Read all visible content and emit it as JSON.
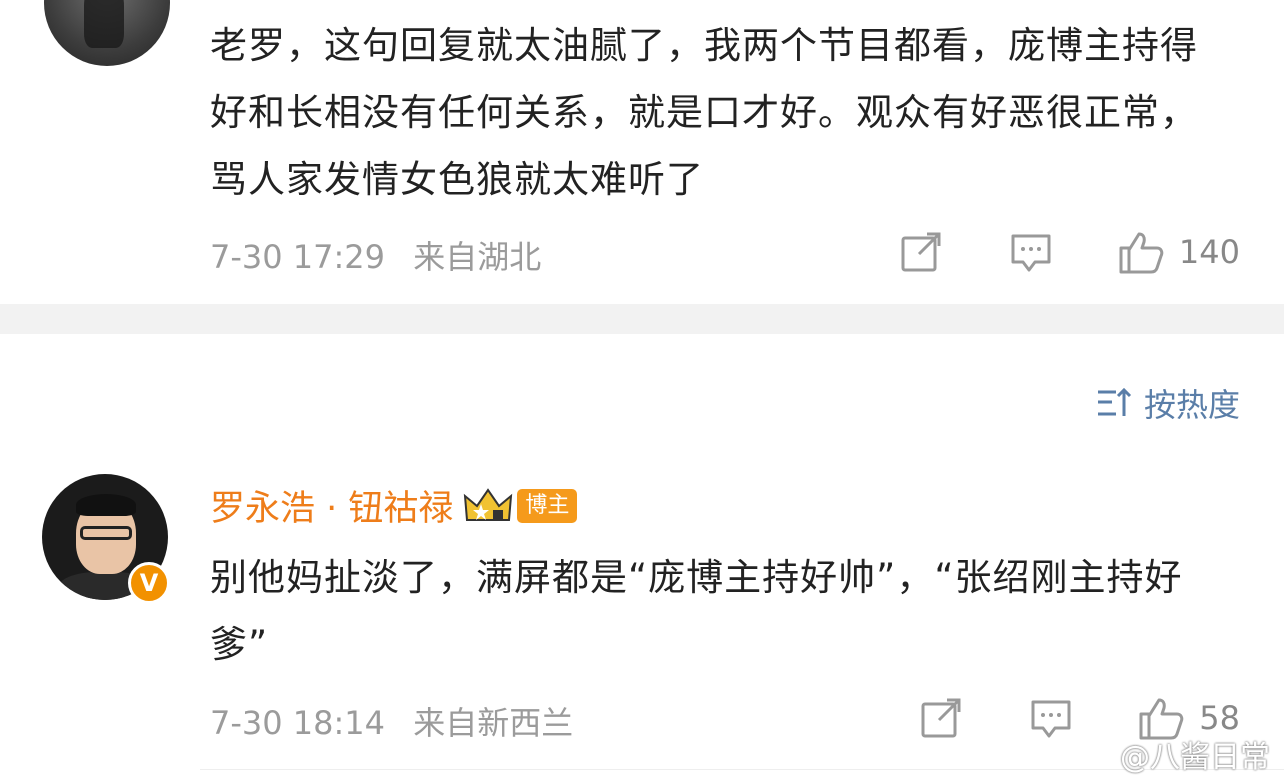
{
  "comments": [
    {
      "text": "老罗，这句回复就太油腻了，我两个节目都看，庞博主持得好和长相没有任何关系，就是口才好。观众有好恶很正常，骂人家发情女色狼就太难听了",
      "date": "7-30 17:29",
      "location": "来自湖北",
      "likes": "140"
    },
    {
      "username": "罗永浩 · 钮祜禄",
      "role_badge": "博主",
      "verified_mark": "V",
      "text": "别他妈扯淡了，满屏都是“庞博主持好帅”，“张绍刚主持好爹”",
      "date": "7-30 18:14",
      "location": "来自新西兰",
      "likes": "58"
    }
  ],
  "sort_label": "按热度",
  "watermark": "@八酱日常",
  "icons": {
    "share": "share-icon",
    "reply": "comment-icon",
    "like": "thumbs-up-icon",
    "sort": "sort-icon",
    "crown": "crown-icon",
    "weibo": "weibo-logo-icon"
  },
  "colors": {
    "username": "#ee7d1a",
    "sort": "#5a7ea8",
    "meta": "#9b9b9b",
    "badge": "#f59a1b"
  }
}
